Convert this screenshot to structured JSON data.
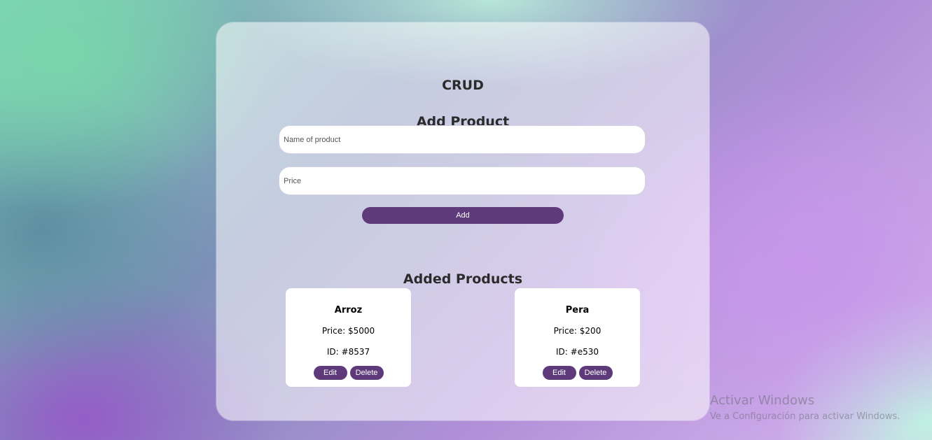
{
  "app": {
    "title": "CRUD"
  },
  "form": {
    "heading": "Add Product",
    "name_placeholder": "Name of product",
    "price_placeholder": "Price",
    "add_label": "Add"
  },
  "list": {
    "heading": "Added Products",
    "products": [
      {
        "name": "Arroz",
        "price": "Price: $5000",
        "id": "ID: #8537",
        "edit_label": "Edit",
        "delete_label": "Delete"
      },
      {
        "name": "Pera",
        "price": "Price: $200",
        "id": "ID: #e530",
        "edit_label": "Edit",
        "delete_label": "Delete"
      }
    ]
  },
  "watermark": {
    "line1": "Activar Windows",
    "line2": "Ve a Configuración para activar Windows."
  },
  "colors": {
    "accent": "#5e3a7a",
    "card_bg": "#ffffff",
    "text_dark": "#2b2b2b"
  }
}
